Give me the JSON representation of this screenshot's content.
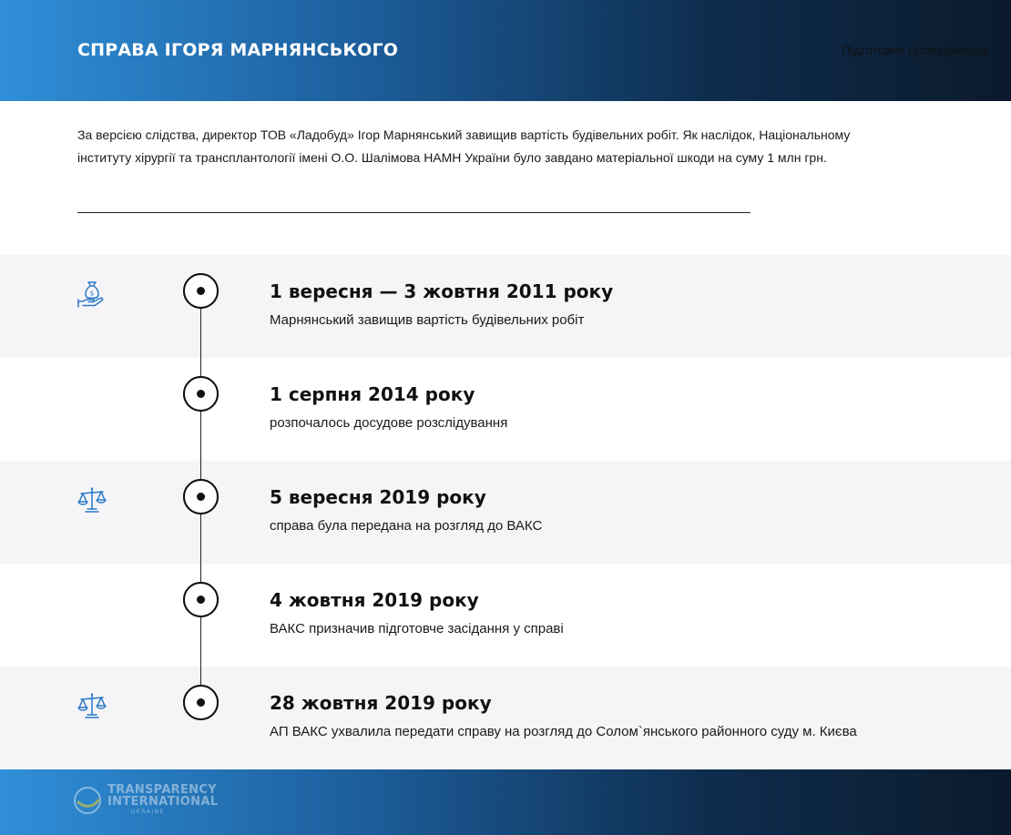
{
  "header": {
    "title": "СПРАВА ІГОРЯ МАРНЯНСЬКОГО",
    "stage": "Підготовче провадження"
  },
  "intro": {
    "text": "За версією слідства, директор ТОВ «Ладобуд» Ігор Марнянський завищив вартість будівельних робіт. Як наслідок, Національному інституту хірургії та трансплантології імені О.О. Шалімова НАМН України було завдано матеріальної шкоди на суму 1 млн грн."
  },
  "timeline": {
    "events": [
      {
        "date": "1 вересня — 3 жовтня 2011 року",
        "description": "Марнянський завищив вартість будівельних робіт",
        "icon": "money-bag-hand-icon"
      },
      {
        "date": "1 серпня 2014 року",
        "description": "розпочалось досудове розслідування",
        "icon": ""
      },
      {
        "date": "5 вересня 2019 року",
        "description": "справа була передана на розгляд до ВАКС",
        "icon": "scales-icon"
      },
      {
        "date": "4 жовтня 2019 року",
        "description": "ВАКС призначив підготовче засідання у справі",
        "icon": ""
      },
      {
        "date": "28 жовтня 2019 року",
        "description": "АП ВАКС ухвалила передати справу на розгляд до Солом`янського районного суду м. Києва",
        "icon": "scales-icon"
      }
    ]
  },
  "footer": {
    "logo_line1": "TRANSPARENCY",
    "logo_line2": "INTERNATIONAL",
    "logo_line3": "UKRAINE"
  },
  "colors": {
    "accent_blue": "#2f8fd8",
    "dark_navy": "#0b1a2c",
    "icon_blue": "#2a78c8",
    "row_shade": "#f5f5f7"
  }
}
